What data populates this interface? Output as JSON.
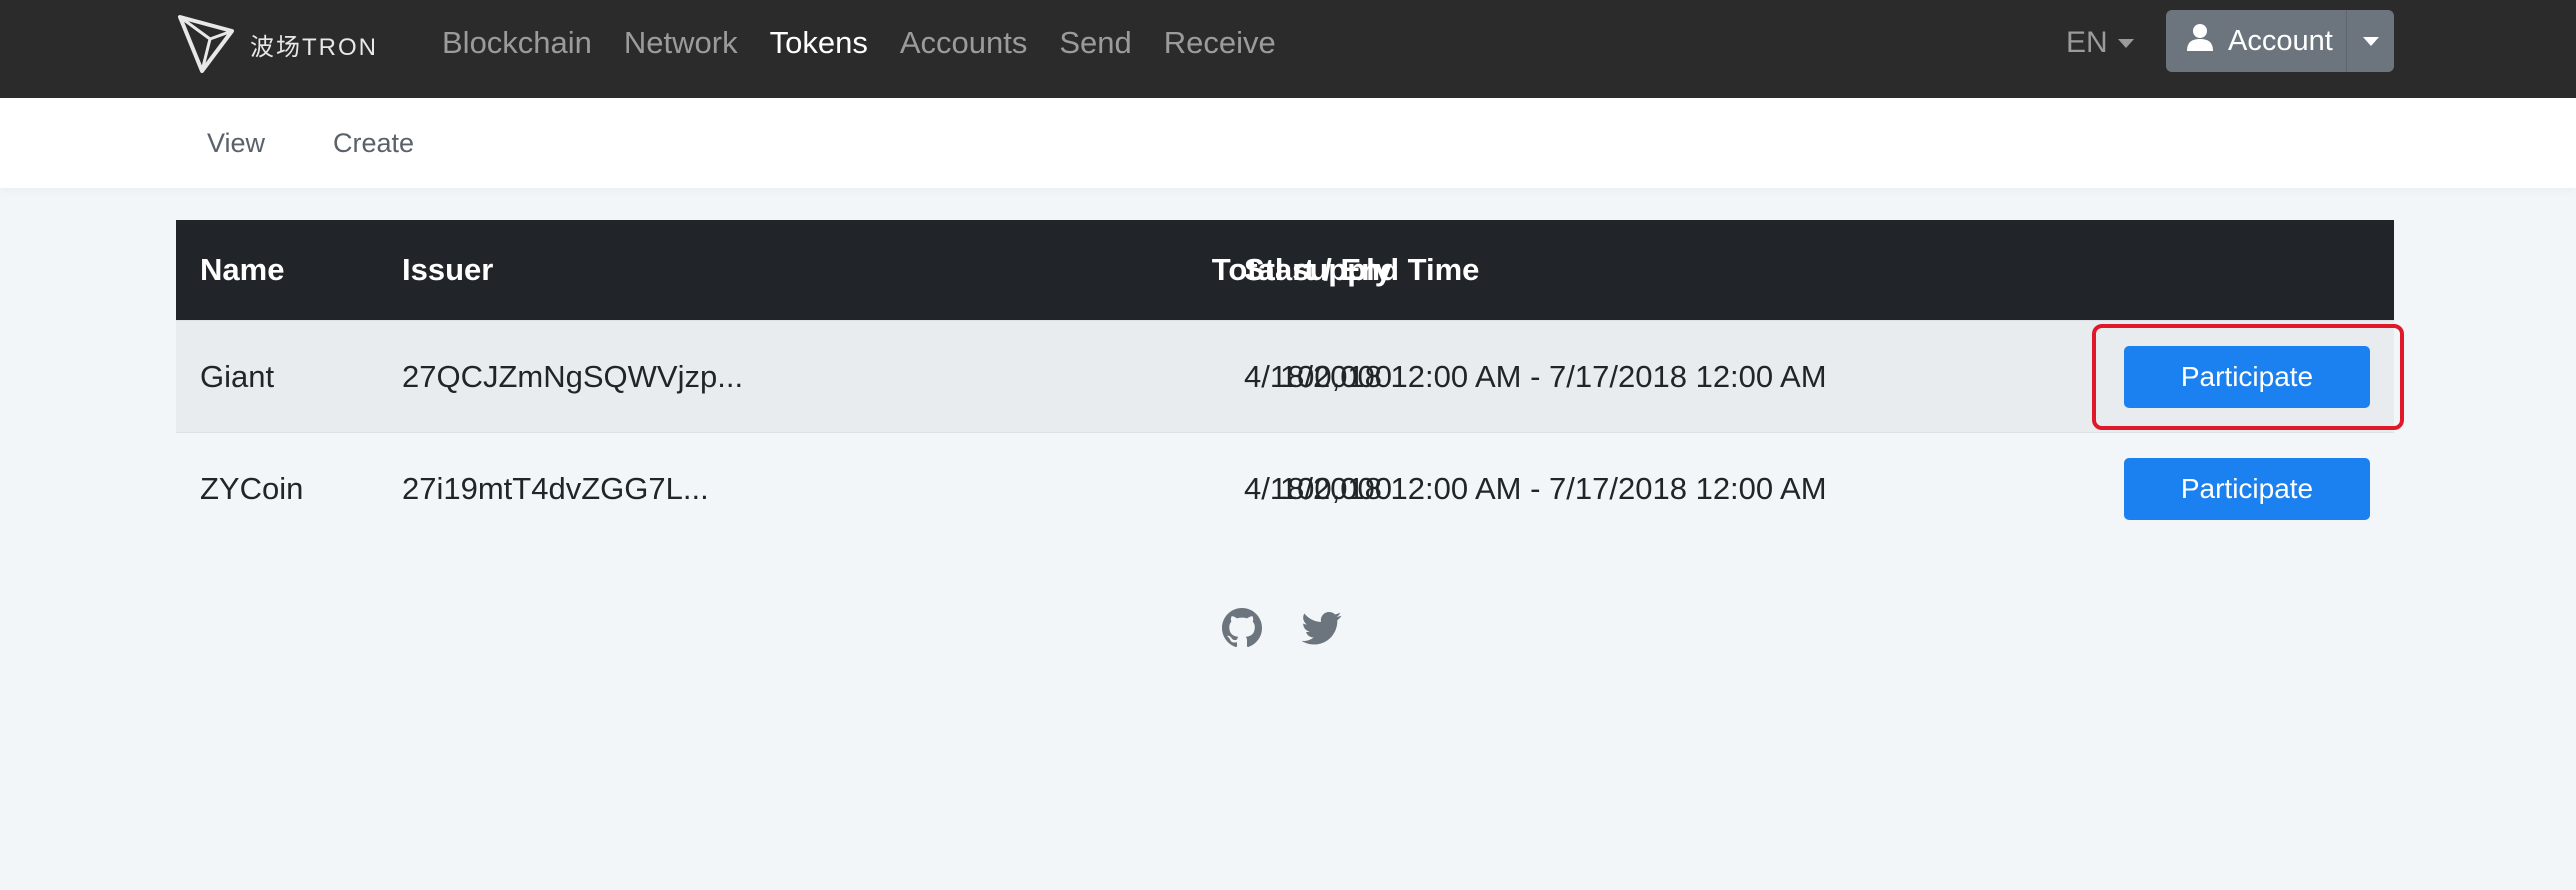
{
  "brand": {
    "text": "波场TRON",
    "logo_icon": "tron-logo-icon"
  },
  "nav": {
    "items": [
      {
        "label": "Blockchain",
        "active": false
      },
      {
        "label": "Network",
        "active": false
      },
      {
        "label": "Tokens",
        "active": true
      },
      {
        "label": "Accounts",
        "active": false
      },
      {
        "label": "Send",
        "active": false
      },
      {
        "label": "Receive",
        "active": false
      }
    ],
    "language": "EN",
    "account_label": "Account"
  },
  "subnav": {
    "items": [
      {
        "label": "View"
      },
      {
        "label": "Create"
      }
    ]
  },
  "table": {
    "headers": {
      "name": "Name",
      "issuer": "Issuer",
      "supply": "Total supply",
      "time": "Start / End Time"
    },
    "rows": [
      {
        "name": "Giant",
        "issuer": "27QCJZmNgSQWVjzp...",
        "supply": "100,000",
        "time": "4/18/2018 12:00 AM  - 7/17/2018 12:00 AM",
        "action": "Participate"
      },
      {
        "name": "ZYCoin",
        "issuer": "27i19mtT4dvZGG7L...",
        "supply": "100,000",
        "time": "4/18/2018 12:00 AM  - 7/17/2018 12:00 AM",
        "action": "Participate"
      }
    ]
  },
  "footer": {
    "icons": [
      "github-icon",
      "twitter-icon"
    ]
  },
  "colors": {
    "navbar": "#2b2b2b",
    "primary": "#1b80f0",
    "highlight": "#e0192a",
    "table_head": "#212529"
  }
}
